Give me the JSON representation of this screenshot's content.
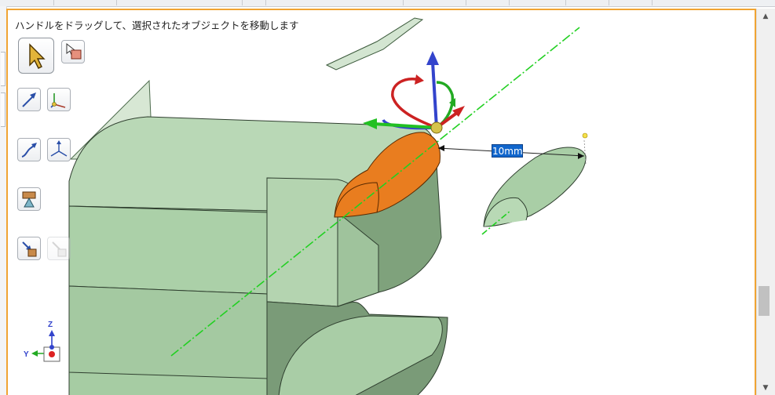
{
  "viewport": {
    "hint_text": "ハンドルをドラッグして、選択されたオブジェクトを移動します",
    "dimension_value": "10mm"
  },
  "toolbar": {
    "items": [
      {
        "name": "select-tool",
        "icon": "arrow-cursor-icon",
        "state": "active"
      },
      {
        "name": "select-face-tool",
        "icon": "cursor-box-icon",
        "state": "normal"
      },
      {
        "name": "move-along-vector-tool",
        "icon": "diagonal-arrow-icon",
        "state": "normal"
      },
      {
        "name": "move-along-axis-tool",
        "icon": "axis-arrow-icon",
        "state": "normal"
      },
      {
        "name": "move-along-curve-tool",
        "icon": "curved-arrow-icon",
        "state": "normal"
      },
      {
        "name": "move-to-point-tool",
        "icon": "axes-arrows-icon",
        "state": "normal"
      },
      {
        "name": "anchor-tool",
        "icon": "anchor-block-icon",
        "state": "normal"
      },
      {
        "name": "pull-tool",
        "icon": "pull-arrow-icon",
        "state": "normal"
      },
      {
        "name": "disabled-tool",
        "icon": "ghost-tool-icon",
        "state": "disabled"
      }
    ]
  },
  "triad": {
    "axes": [
      "Z",
      "Y"
    ]
  },
  "colors": {
    "model_face": "#a9cfa6",
    "model_shadow": "#7c9e7b",
    "selected_face": "#e97d1f",
    "axis_line": "#22d022",
    "handle_z": "#3344cc",
    "handle_x": "#cc2222",
    "handle_y": "#22aa22",
    "viewport_border": "#f0a433"
  }
}
